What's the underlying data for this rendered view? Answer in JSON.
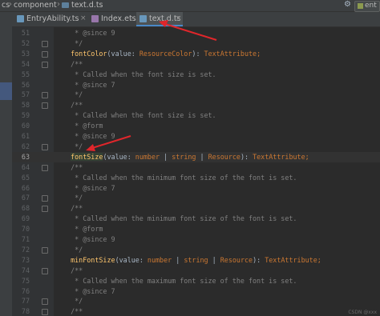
{
  "breadcrumb": {
    "root": "cs",
    "folder": "component",
    "file": "text.d.ts"
  },
  "top_right": {
    "gear": "⚙",
    "run_label": "ent"
  },
  "tabs": [
    {
      "label": "EntryAbility.ts",
      "close": "×",
      "icon_color": "#6897bb",
      "active": false
    },
    {
      "label": "Index.ets",
      "close": "×",
      "icon_color": "#9876aa",
      "active": false
    },
    {
      "label": "text.d.ts",
      "close": "×",
      "icon_color": "#6897bb",
      "active": true
    }
  ],
  "lines": [
    {
      "n": "51",
      "tokens": [
        {
          "t": "   * @since 9",
          "k": "c"
        }
      ]
    },
    {
      "n": "52",
      "tokens": [
        {
          "t": "   */",
          "k": "c"
        }
      ]
    },
    {
      "n": "53",
      "tokens": [
        {
          "t": "  ",
          "k": "pp"
        },
        {
          "t": "fontColor",
          "k": "fn"
        },
        {
          "t": "(",
          "k": "pp"
        },
        {
          "t": "value",
          "k": "pn"
        },
        {
          "t": ": ",
          "k": "pp"
        },
        {
          "t": "ResourceColor",
          "k": "ty"
        },
        {
          "t": "): ",
          "k": "pp"
        },
        {
          "t": "TextAttribute",
          "k": "ty"
        },
        {
          "t": ";",
          "k": "kw"
        }
      ]
    },
    {
      "n": "54",
      "tokens": [
        {
          "t": "  /**",
          "k": "c"
        }
      ]
    },
    {
      "n": "55",
      "tokens": [
        {
          "t": "   * Called when the font size is set.",
          "k": "c"
        }
      ]
    },
    {
      "n": "56",
      "tokens": [
        {
          "t": "   * @since 7",
          "k": "c"
        }
      ]
    },
    {
      "n": "57",
      "tokens": [
        {
          "t": "   */",
          "k": "c"
        }
      ]
    },
    {
      "n": "58",
      "tokens": [
        {
          "t": "  /**",
          "k": "c"
        }
      ]
    },
    {
      "n": "59",
      "tokens": [
        {
          "t": "   * Called when the font size is set.",
          "k": "c"
        }
      ]
    },
    {
      "n": "60",
      "tokens": [
        {
          "t": "   * @form",
          "k": "c"
        }
      ]
    },
    {
      "n": "61",
      "tokens": [
        {
          "t": "   * @since 9",
          "k": "c"
        }
      ]
    },
    {
      "n": "62",
      "tokens": [
        {
          "t": "   */",
          "k": "c"
        }
      ]
    },
    {
      "n": "63",
      "current": true,
      "tokens": [
        {
          "t": "  ",
          "k": "pp"
        },
        {
          "t": "fontSize",
          "k": "fn-sel"
        },
        {
          "t": "(",
          "k": "pp"
        },
        {
          "t": "value",
          "k": "pn"
        },
        {
          "t": ": ",
          "k": "pp"
        },
        {
          "t": "number",
          "k": "ty"
        },
        {
          "t": " | ",
          "k": "pp"
        },
        {
          "t": "string",
          "k": "ty"
        },
        {
          "t": " | ",
          "k": "pp"
        },
        {
          "t": "Resource",
          "k": "ty"
        },
        {
          "t": "): ",
          "k": "pp"
        },
        {
          "t": "TextAttribute",
          "k": "ty"
        },
        {
          "t": ";",
          "k": "kw"
        }
      ]
    },
    {
      "n": "64",
      "tokens": [
        {
          "t": "  /**",
          "k": "c"
        }
      ]
    },
    {
      "n": "65",
      "tokens": [
        {
          "t": "   * Called when the minimum font size of the font is set.",
          "k": "c"
        }
      ]
    },
    {
      "n": "66",
      "tokens": [
        {
          "t": "   * @since 7",
          "k": "c"
        }
      ]
    },
    {
      "n": "67",
      "tokens": [
        {
          "t": "   */",
          "k": "c"
        }
      ]
    },
    {
      "n": "68",
      "tokens": [
        {
          "t": "  /**",
          "k": "c"
        }
      ]
    },
    {
      "n": "69",
      "tokens": [
        {
          "t": "   * Called when the minimum font size of the font is set.",
          "k": "c"
        }
      ]
    },
    {
      "n": "70",
      "tokens": [
        {
          "t": "   * @form",
          "k": "c"
        }
      ]
    },
    {
      "n": "71",
      "tokens": [
        {
          "t": "   * @since 9",
          "k": "c"
        }
      ]
    },
    {
      "n": "72",
      "tokens": [
        {
          "t": "   */",
          "k": "c"
        }
      ]
    },
    {
      "n": "73",
      "tokens": [
        {
          "t": "  ",
          "k": "pp"
        },
        {
          "t": "minFontSize",
          "k": "fn"
        },
        {
          "t": "(",
          "k": "pp"
        },
        {
          "t": "value",
          "k": "pn"
        },
        {
          "t": ": ",
          "k": "pp"
        },
        {
          "t": "number",
          "k": "ty"
        },
        {
          "t": " | ",
          "k": "pp"
        },
        {
          "t": "string",
          "k": "ty"
        },
        {
          "t": " | ",
          "k": "pp"
        },
        {
          "t": "Resource",
          "k": "ty"
        },
        {
          "t": "): ",
          "k": "pp"
        },
        {
          "t": "TextAttribute",
          "k": "ty"
        },
        {
          "t": ";",
          "k": "kw"
        }
      ]
    },
    {
      "n": "74",
      "tokens": [
        {
          "t": "  /**",
          "k": "c"
        }
      ]
    },
    {
      "n": "75",
      "tokens": [
        {
          "t": "   * Called when the maximum font size of the font is set.",
          "k": "c"
        }
      ]
    },
    {
      "n": "76",
      "tokens": [
        {
          "t": "   * @since 7",
          "k": "c"
        }
      ]
    },
    {
      "n": "77",
      "tokens": [
        {
          "t": "   */",
          "k": "c"
        }
      ]
    },
    {
      "n": "78",
      "tokens": [
        {
          "t": "  /**",
          "k": "c"
        }
      ]
    }
  ],
  "fold_lines": [
    "52",
    "53",
    "54",
    "57",
    "58",
    "62",
    "64",
    "67",
    "68",
    "72",
    "74",
    "77",
    "78"
  ],
  "annotation_color": "#e0262b",
  "watermark": "CSDN @xxx"
}
